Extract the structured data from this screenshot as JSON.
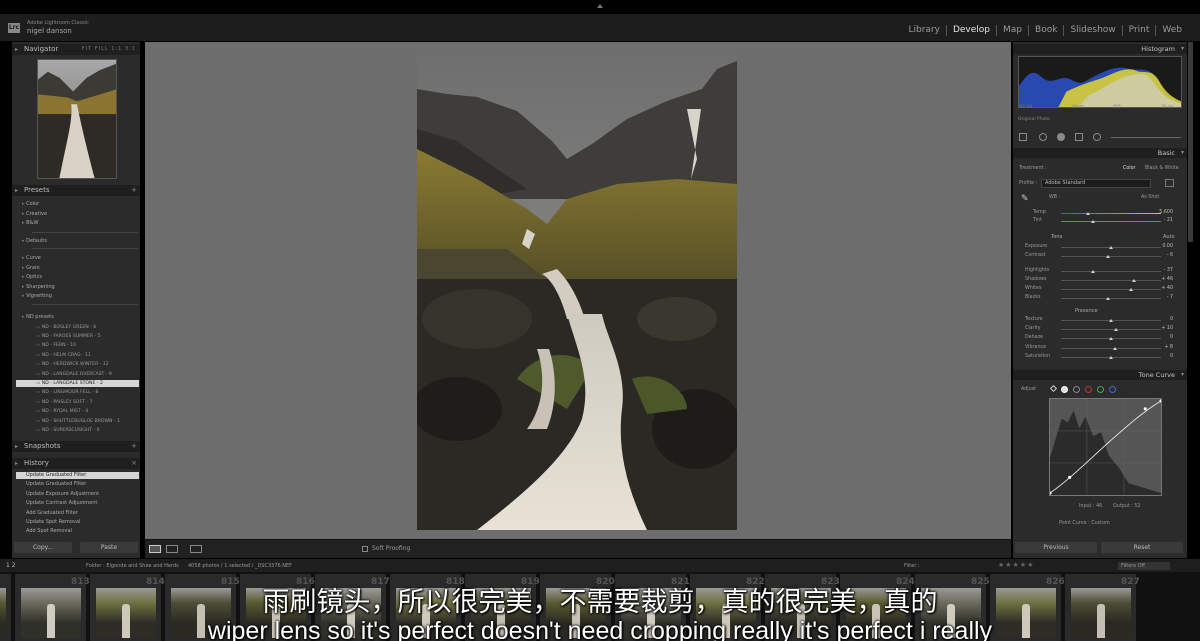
{
  "identity": {
    "logo": "Lrc",
    "product": "Adobe Lightroom Classic",
    "user": "nigel danson"
  },
  "modules": [
    "Library",
    "Develop",
    "Map",
    "Book",
    "Slideshow",
    "Print",
    "Web"
  ],
  "active_module": "Develop",
  "left_panel": {
    "navigator": {
      "title": "Navigator",
      "zoom_options": "FIT  FILL  1:1  3:1"
    },
    "presets": {
      "title": "Presets",
      "groups_a": [
        "Color",
        "Creative",
        "B&W"
      ],
      "groups_b": [
        "Defaults"
      ],
      "groups_c": [
        "Curve",
        "Grain",
        "Optics",
        "Sharpening",
        "Vignetting"
      ],
      "nd_group": "ND presets",
      "nd_items": [
        "ND - BOSLEY GREEN - 6",
        "ND - FAROES SUMMER - 5",
        "ND - FERN - 10",
        "ND - HELM CRAG - 11",
        "ND - HERDWICK WINTER - 12",
        "ND - LANGDALE OVERCAST - 9",
        "ND - LANGDALE STONE - 2",
        "ND - LINGMOOR FELL - 8",
        "ND - PAISLEY SOFT - 7",
        "ND - RYDAL MIST - 4",
        "ND - SHUTTLEBUGLOE BROWN - 1",
        "ND - SUPERSCUSIGHT - 0"
      ],
      "selected_index": 6
    },
    "snapshots": {
      "title": "Snapshots"
    },
    "history": {
      "title": "History",
      "items": [
        "Update Graduated Filter",
        "Update Graduated Filter",
        "Update Exposure Adjustment",
        "Update Contrast Adjustment",
        "Add Graduated Filter",
        "Update Spot Removal",
        "Add Spot Removal"
      ],
      "selected_index": 0
    },
    "copy_label": "Copy...",
    "paste_label": "Paste"
  },
  "toolbar": {
    "soft_proofing": "Soft Proofing"
  },
  "right_panel": {
    "histogram_title": "Histogram",
    "histogram_labels": [
      "ISO 64",
      "14mm",
      "f/16",
      "30 sec"
    ],
    "original_photo": "Original Photo",
    "basic": {
      "title": "Basic",
      "treatment_label": "Treatment :",
      "treatment_color": "Color",
      "treatment_bw": "Black & White",
      "profile_label": "Profile :",
      "profile_value": "Adobe Standard",
      "wb_label": "WB :",
      "wb_value": "As Shot",
      "temp_label": "Temp",
      "temp_value": "5,600",
      "tint_label": "Tint",
      "tint_value": "- 21",
      "tone_label": "Tone",
      "tone_auto": "Auto",
      "tone_rows": [
        {
          "label": "Exposure",
          "value": "0.00",
          "pos": 0.5
        },
        {
          "label": "Contrast",
          "value": "- 6",
          "pos": 0.47
        },
        {
          "label": "Highlights",
          "value": "- 37",
          "pos": 0.32
        },
        {
          "label": "Shadows",
          "value": "+ 46",
          "pos": 0.73
        },
        {
          "label": "Whites",
          "value": "+ 40",
          "pos": 0.7
        },
        {
          "label": "Blacks",
          "value": "- 7",
          "pos": 0.47
        }
      ],
      "presence_label": "Presence",
      "presence_rows": [
        {
          "label": "Texture",
          "value": "0",
          "pos": 0.5
        },
        {
          "label": "Clarity",
          "value": "+ 10",
          "pos": 0.55
        },
        {
          "label": "Dehaze",
          "value": "0",
          "pos": 0.5
        },
        {
          "label": "Vibrance",
          "value": "+ 8",
          "pos": 0.54
        },
        {
          "label": "Saturation",
          "value": "0",
          "pos": 0.5
        }
      ]
    },
    "tone_curve": {
      "title": "Tone Curve",
      "adjust_label": "Adjust",
      "input_label": "Input : 46",
      "output_label": "Output : 52",
      "point_curve_label": "Point Curve : Custom"
    },
    "previous_label": "Previous",
    "reset_label": "Reset"
  },
  "filmstrip": {
    "pages": "1 2",
    "folder_text": "Folder : Elgonde and Shee and Herds",
    "count_text": "4058 photos / 1 selected / _DSC3376.NEF",
    "filter_label": "Filter :",
    "filter_value": "Filters Off",
    "numbers": [
      "",
      "813",
      "814",
      "815",
      "816",
      "817",
      "818",
      "819",
      "820",
      "821",
      "822",
      "823",
      "824",
      "825",
      "826",
      "827"
    ]
  },
  "subtitles": {
    "zh": "雨刷镜头，所以很完美，不需要裁剪，真的很完美，真的",
    "en": "wiper lens so it's perfect doesn't need cropping really it's perfect i really"
  }
}
